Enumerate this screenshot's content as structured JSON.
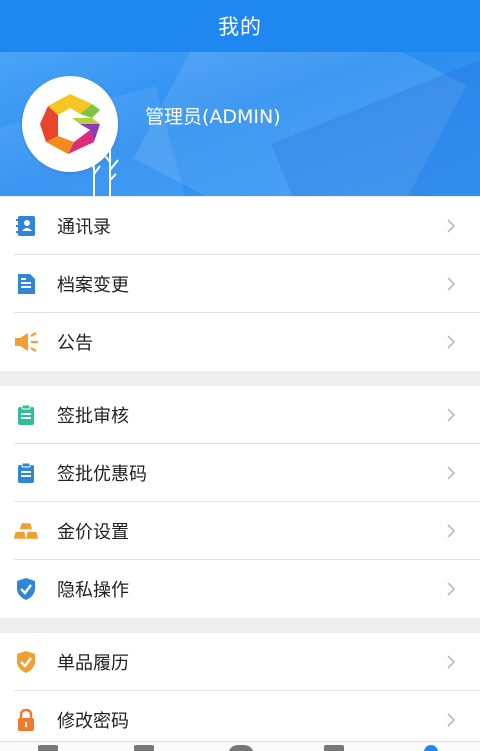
{
  "header": {
    "title": "我的"
  },
  "profile": {
    "username": "管理员(ADMIN)"
  },
  "sections": [
    {
      "items": [
        {
          "label": "通讯录",
          "icon": "contacts-icon",
          "color": "#2f86d6"
        },
        {
          "label": "档案变更",
          "icon": "document-icon",
          "color": "#2f86d6"
        },
        {
          "label": "公告",
          "icon": "megaphone-icon",
          "color": "#f0a030"
        }
      ]
    },
    {
      "items": [
        {
          "label": "签批审核",
          "icon": "clipboard-icon",
          "color": "#2ebf9a"
        },
        {
          "label": "签批优惠码",
          "icon": "clipboard-icon",
          "color": "#2f86d6"
        },
        {
          "label": "金价设置",
          "icon": "gold-bars-icon",
          "color": "#f0a030"
        },
        {
          "label": "隐私操作",
          "icon": "shield-check-icon",
          "color": "#2f86d6"
        }
      ]
    },
    {
      "items": [
        {
          "label": "单品履历",
          "icon": "shield-check-icon",
          "color": "#f0a030"
        },
        {
          "label": "修改密码",
          "icon": "lock-icon",
          "color": "#f07a30"
        }
      ]
    }
  ],
  "bottom_nav": {
    "active_color": "#1e88f0"
  }
}
